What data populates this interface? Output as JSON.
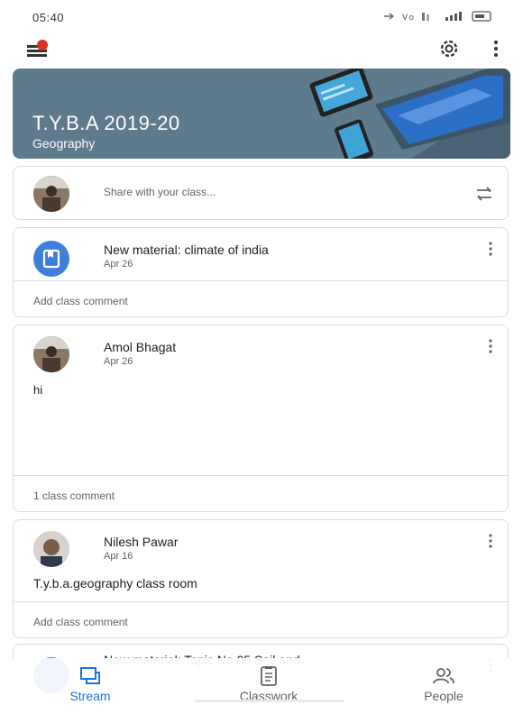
{
  "status_bar": {
    "time": "05:40",
    "indicators": "⇜ ₇ ̷⁑ .∥ ▭"
  },
  "app_bar": {
    "menu_icon": "menu-with-red-dot-icon",
    "settings_icon": "gear-icon",
    "more_icon": "more-vertical-icon"
  },
  "banner": {
    "title": "T.Y.B.A 2019-20",
    "subtitle": "Geography",
    "color": "#5e7a8d"
  },
  "share": {
    "placeholder": "Share with your class..."
  },
  "posts": [
    {
      "type": "material",
      "title": "New material: climate of india",
      "date": "Apr 26",
      "footer": "Add class comment"
    },
    {
      "type": "announcement",
      "author": "Amol Bhagat",
      "date": "Apr 26",
      "body": "hi",
      "footer": "1 class comment"
    },
    {
      "type": "announcement",
      "author": "Nilesh Pawar",
      "date": "Apr 16",
      "body": "T.y.b.a.geography class room",
      "footer": "Add class comment"
    },
    {
      "type": "material",
      "title": "New material: Topic No 05 Soil and"
    }
  ],
  "bottom_nav": {
    "items": [
      {
        "label": "Stream",
        "icon": "stream-icon",
        "active": true
      },
      {
        "label": "Classwork",
        "icon": "classwork-icon",
        "active": false
      },
      {
        "label": "People",
        "icon": "people-icon",
        "active": false
      }
    ],
    "active_color": "#1a73e8",
    "inactive_color": "#5f6368"
  }
}
